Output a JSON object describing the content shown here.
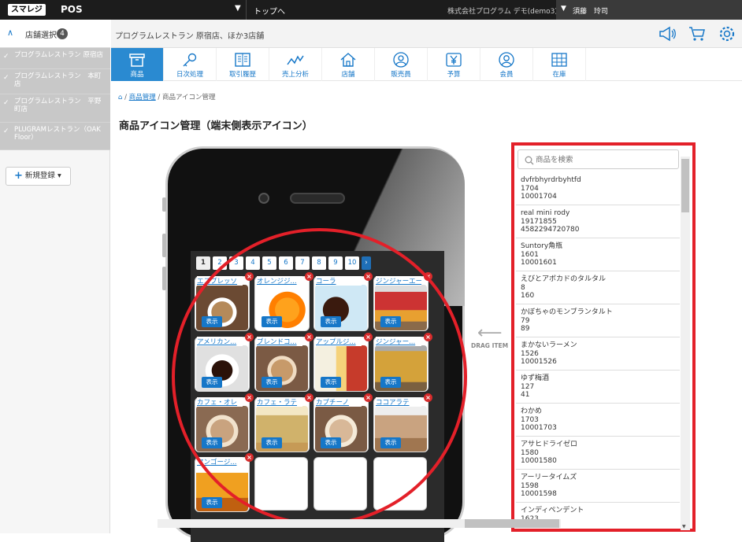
{
  "topbar": {
    "logo": "スマレジ",
    "app": "POS",
    "nav": "トップへ",
    "company": "株式会社プログラム デモ(demo3)",
    "user": "須藤　玲司"
  },
  "sidebar": {
    "store_select_label": "店舗選択",
    "store_count": "4",
    "stores": [
      "プログラムレストラン 原宿店",
      "プログラムレストラン　本町店",
      "プログラムレストラン　平野町店",
      "PLUGRAMレストラン（OAK Floor）"
    ],
    "new_button": "新規登録"
  },
  "header": {
    "store_name": "プログラムレストラン 原宿店、ほか3店舗"
  },
  "nav": [
    "商品",
    "日次処理",
    "取引履歴",
    "売上分析",
    "店舗",
    "販売員",
    "予算",
    "会員",
    "在庫"
  ],
  "breadcrumb": {
    "link": "商品管理",
    "sep": "/",
    "current": "商品アイコン管理"
  },
  "page_title": "商品アイコン管理（端末側表示アイコン）",
  "pagination": [
    "1",
    "2",
    "3",
    "4",
    "5",
    "6",
    "7",
    "8",
    "9",
    "10"
  ],
  "tiles": [
    {
      "name": "エスプレッソ",
      "show": "表示"
    },
    {
      "name": "オレンジジ...",
      "show": "表示"
    },
    {
      "name": "コーラ",
      "show": "表示"
    },
    {
      "name": "ジンジャーエール",
      "show": "表示"
    },
    {
      "name": "アメリカン...",
      "show": "表示"
    },
    {
      "name": "ブレンドコ...",
      "show": "表示"
    },
    {
      "name": "アップルジ...",
      "show": "表示"
    },
    {
      "name": "ジンジャー...",
      "show": "表示"
    },
    {
      "name": "カフェ・オレ",
      "show": "表示"
    },
    {
      "name": "カフェ・ラテ",
      "show": "表示"
    },
    {
      "name": "カプチーノ",
      "show": "表示"
    },
    {
      "name": "ココアラテ",
      "show": "表示"
    },
    {
      "name": "マンゴージ...",
      "show": "表示"
    }
  ],
  "drag_label": "DRAG ITEM",
  "search": {
    "placeholder": "商品を検索"
  },
  "products": [
    {
      "name": "dvfrbhyrdrbyhtfd",
      "id": "1704",
      "code": "10001704"
    },
    {
      "name": "real mini rody",
      "id": "19171855",
      "code": "4582294720780"
    },
    {
      "name": "Suntory角瓶",
      "id": "1601",
      "code": "10001601"
    },
    {
      "name": "えびとアボカドのタルタル",
      "id": "8",
      "code": "160"
    },
    {
      "name": "かぼちゃのモンブランタルト",
      "id": "79",
      "code": "89"
    },
    {
      "name": "まかないラーメン",
      "id": "1526",
      "code": "10001526"
    },
    {
      "name": "ゆず梅酒",
      "id": "127",
      "code": "41"
    },
    {
      "name": "わかめ",
      "id": "1703",
      "code": "10001703"
    },
    {
      "name": "アサヒドライゼロ",
      "id": "1580",
      "code": "10001580"
    },
    {
      "name": "アーリータイムズ",
      "id": "1598",
      "code": "10001598"
    },
    {
      "name": "インディペンデント",
      "id": "1623",
      "code": ""
    }
  ],
  "colors": {
    "accent": "#1677c8",
    "highlight": "#e32029",
    "topbar": "#1c1c1c",
    "delete": "#d62b2b"
  },
  "icons": {
    "cart": "cart-icon",
    "speaker": "megaphone-icon",
    "settings": "gear-icon"
  }
}
